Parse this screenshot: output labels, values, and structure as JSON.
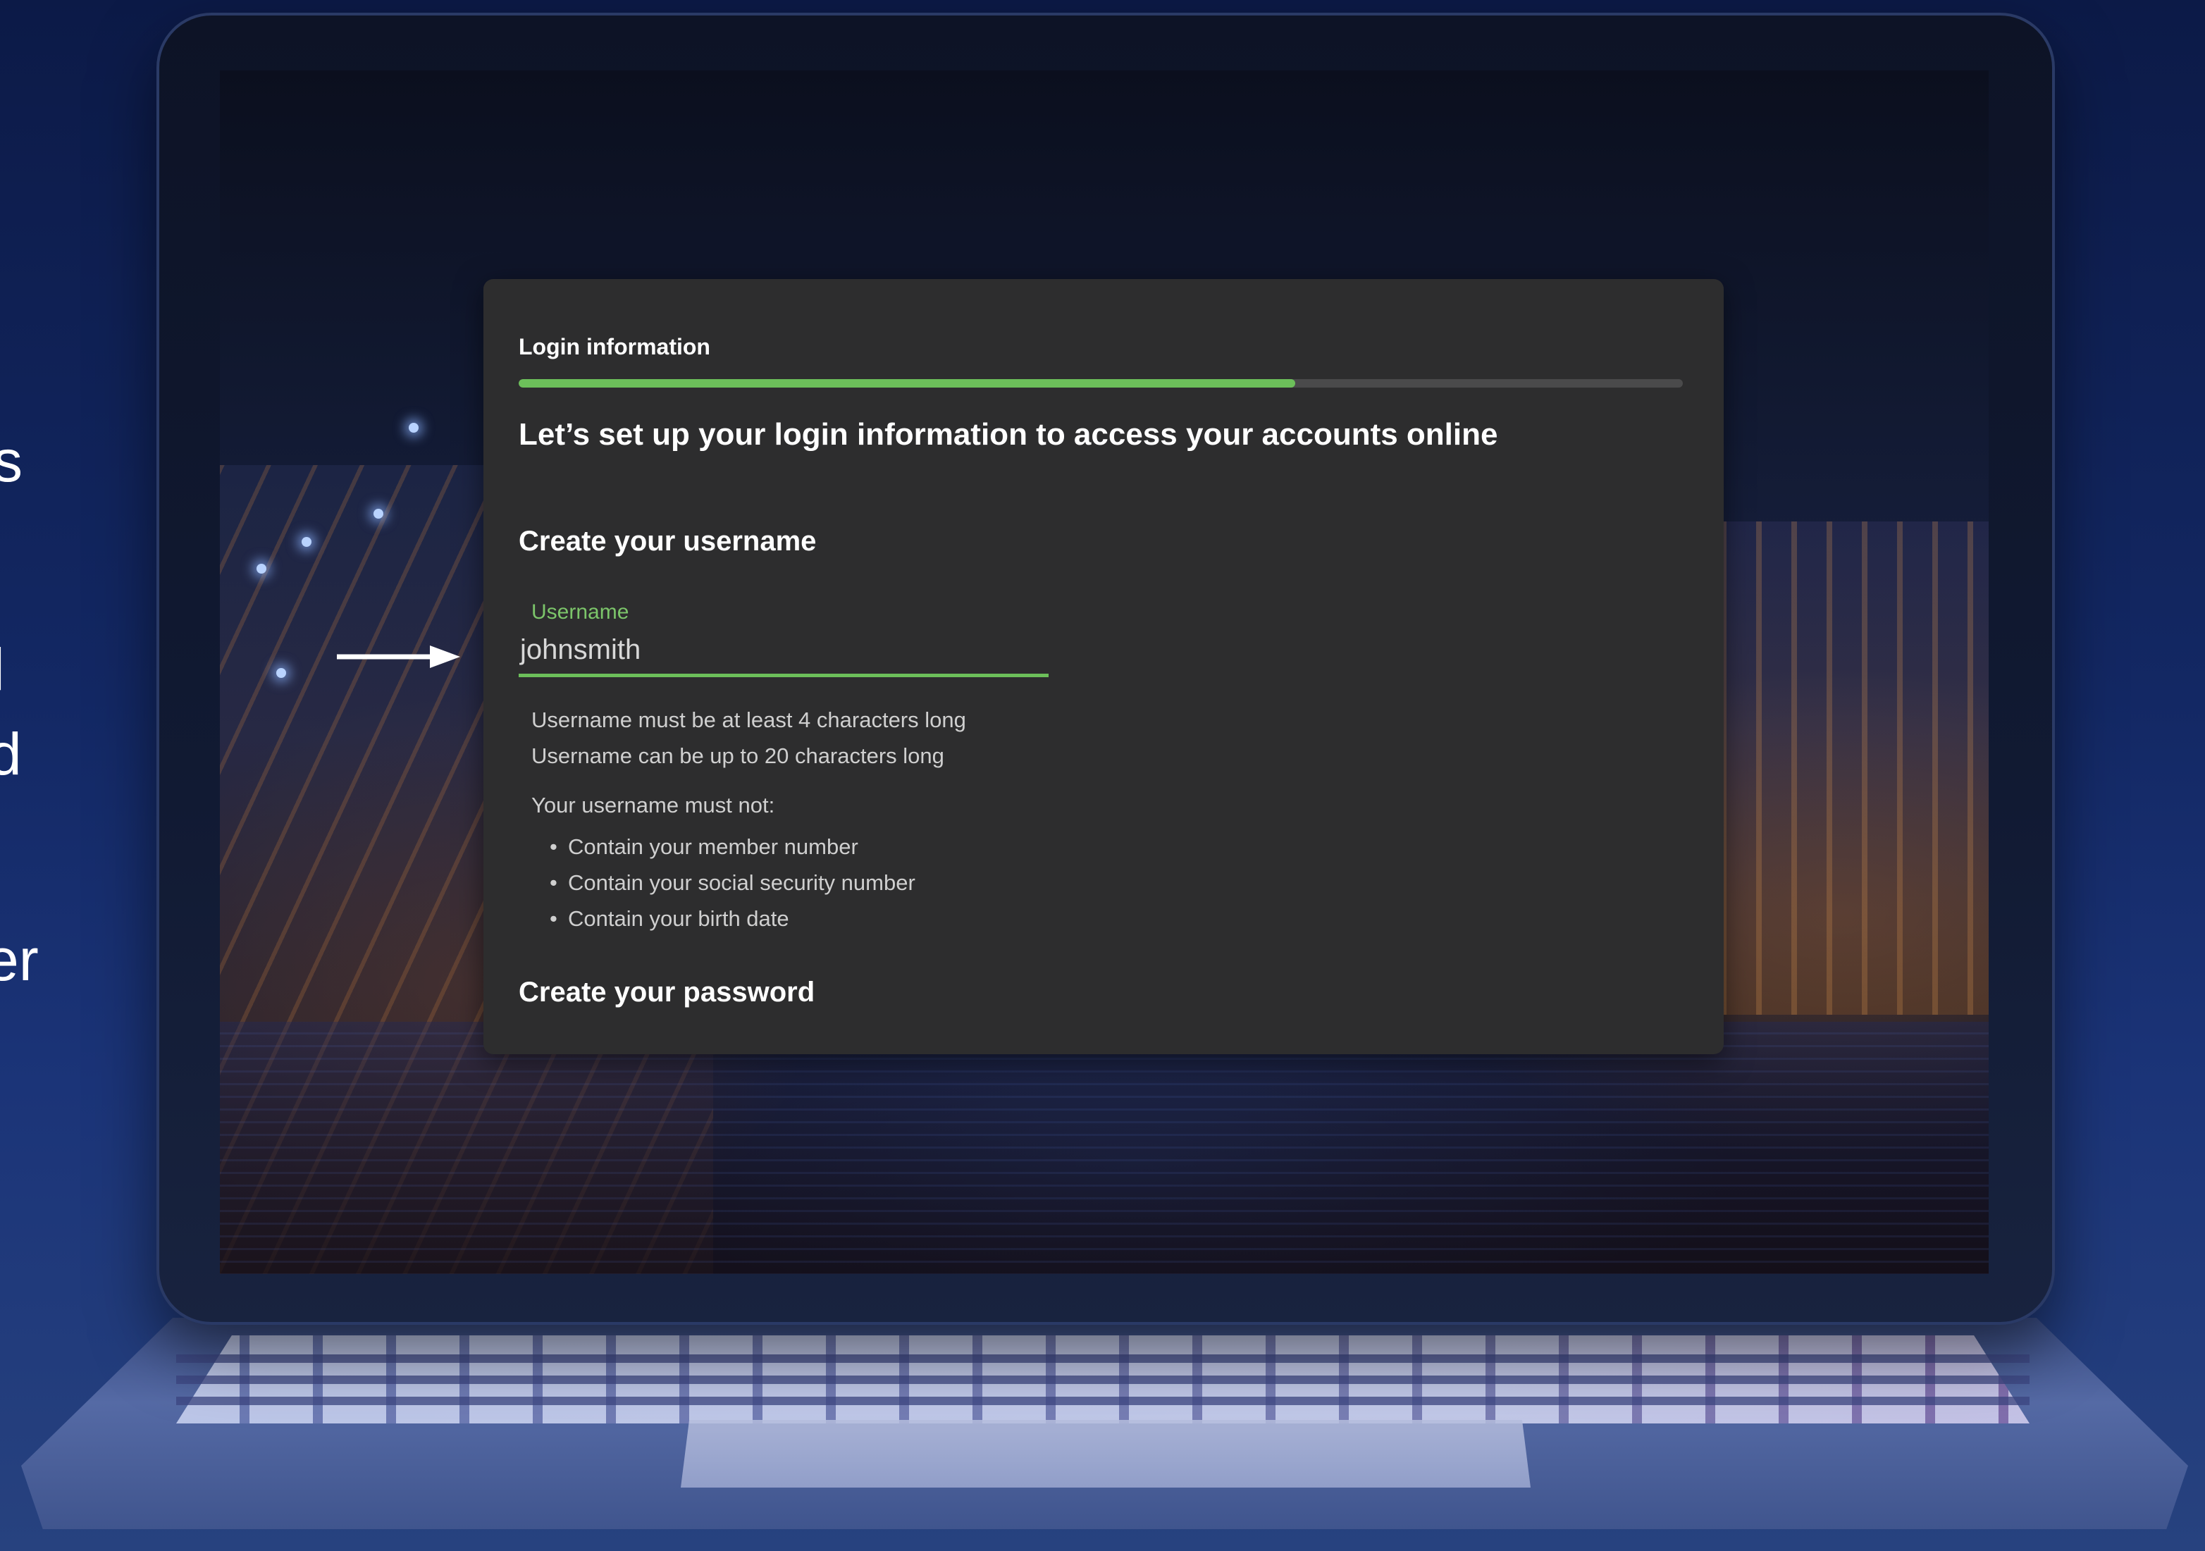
{
  "side_text": [
    "s",
    "l",
    "d",
    "er"
  ],
  "dialog": {
    "step_title": "Login information",
    "progress": 0.667,
    "headline": "Let’s set up your login information to access your accounts online",
    "username_section": {
      "title": "Create your username",
      "field_label": "Username",
      "field_value": "johnsmith",
      "hints": [
        "Username must be at least 4 characters long",
        "Username can be up to 20 characters long"
      ],
      "rules_title": "Your username must not:",
      "rules": [
        "Contain your member number",
        "Contain your social security number",
        "Contain your birth date"
      ]
    },
    "password_section": {
      "title": "Create your password"
    }
  },
  "colors": {
    "accent_green": "#6cbf5a",
    "label_green": "#7cc56a",
    "dialog_bg": "#2d2d2e",
    "page_bg": "#132864"
  },
  "icons": [
    "arrow-right-icon"
  ]
}
